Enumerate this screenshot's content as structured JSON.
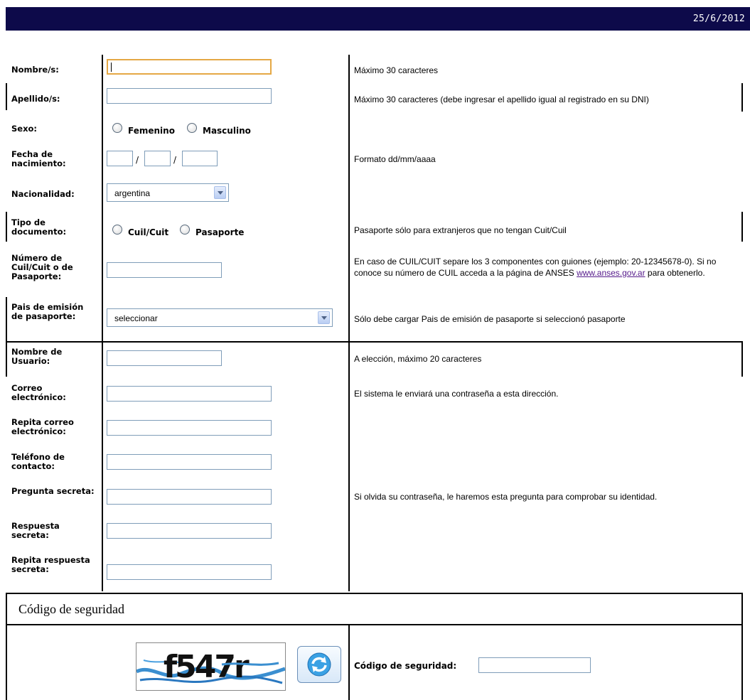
{
  "header": {
    "date": "25/6/2012"
  },
  "form": {
    "nombre": {
      "label": "Nombre/s:",
      "hint": "Máximo 30 caracteres"
    },
    "apellido": {
      "label": "Apellido/s:",
      "hint": "Máximo 30 caracteres (debe ingresar el apellido igual al registrado en su DNI)"
    },
    "sexo": {
      "label": "Sexo:",
      "opt1": "Femenino",
      "opt2": "Masculino"
    },
    "fecha": {
      "label": "Fecha de nacimiento:",
      "sep": "/",
      "hint": "Formato dd/mm/aaaa"
    },
    "nacionalidad": {
      "label": "Nacionalidad:",
      "value": "argentina"
    },
    "tipo_doc": {
      "label": "Tipo de documento:",
      "opt1": "Cuil/Cuit",
      "opt2": "Pasaporte",
      "hint": "Pasaporte sólo para extranjeros que no tengan Cuit/Cuil"
    },
    "numero": {
      "label": "Número de Cuil/Cuit o de Pasaporte:",
      "hint_pre": "En caso de CUIL/CUIT separe los 3 componentes con guiones (ejemplo: 20-12345678-0). Si no conoce su número de CUIL acceda a la página de ANSES ",
      "hint_link": "www.anses.gov.ar",
      "hint_post": " para obtenerlo."
    },
    "pais": {
      "label": "Pais de emisión de pasaporte:",
      "value": "seleccionar",
      "hint": "Sólo debe cargar Pais de emisión de pasaporte si seleccionó pasaporte"
    },
    "usuario": {
      "label": "Nombre de Usuario:",
      "hint": "A elección, máximo 20 caracteres"
    },
    "correo": {
      "label": "Correo electrónico:",
      "hint": "El sistema le enviará una contraseña a esta dirección."
    },
    "repita_correo": {
      "label": "Repita correo electrónico:"
    },
    "telefono": {
      "label": "Teléfono de contacto:"
    },
    "pregunta": {
      "label": "Pregunta secreta:",
      "hint": "Si olvida su contraseña, le haremos esta pregunta para comprobar su identidad."
    },
    "respuesta": {
      "label": "Respuesta secreta:"
    },
    "repita_respuesta": {
      "label": "Repita respuesta secreta:"
    }
  },
  "seguridad": {
    "title": "Código de seguridad",
    "captcha_text": "f547r",
    "code_label": "Código de seguridad:"
  },
  "icons": {
    "refresh": "refresh-icon"
  },
  "colors": {
    "topbar": "#0d0a4a",
    "link": "#551a8b",
    "focus": "#e5a845"
  }
}
